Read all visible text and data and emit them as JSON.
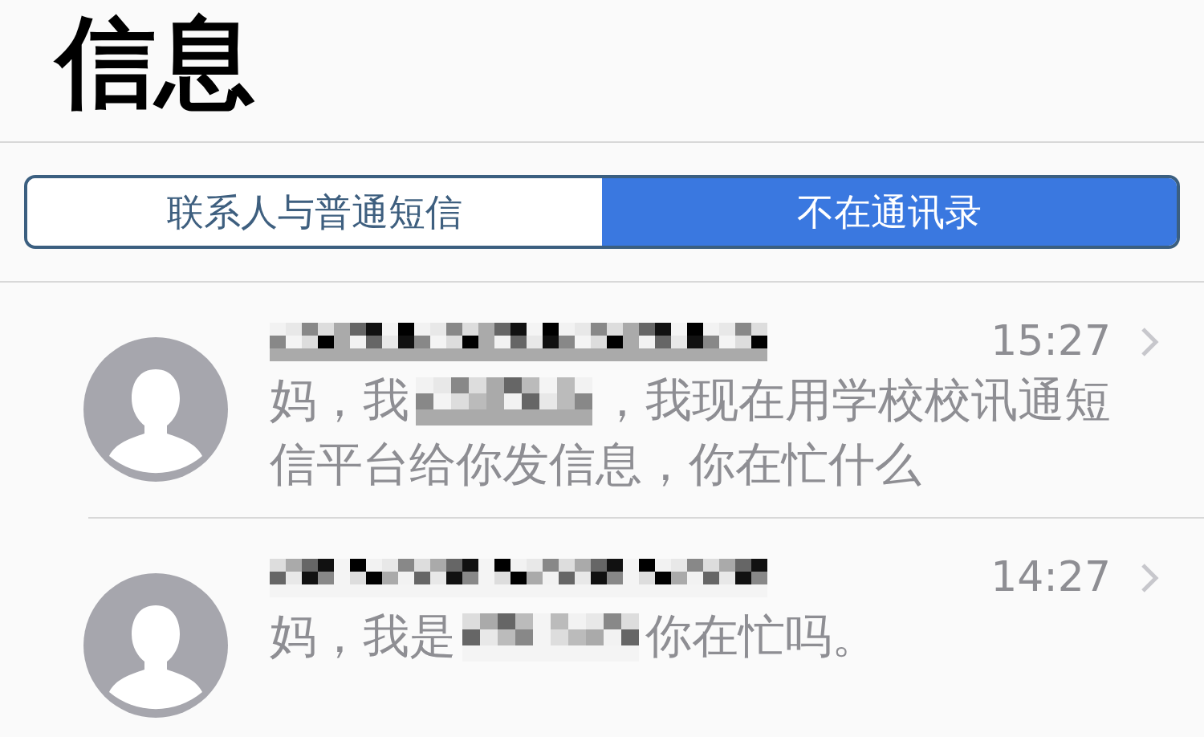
{
  "title": "信息",
  "segments": [
    {
      "label": "联系人与普通短信",
      "selected": false
    },
    {
      "label": "不在通讯录",
      "selected": true
    }
  ],
  "messages": [
    {
      "time": "15:27",
      "preview_before": "妈，我",
      "preview_after": "，我现在用学校校讯通短",
      "preview_continued": "信平台给你发信息，你在忙什么"
    },
    {
      "time": "14:27",
      "preview_before": "妈，我是",
      "preview_after": "你在忙吗。"
    }
  ]
}
